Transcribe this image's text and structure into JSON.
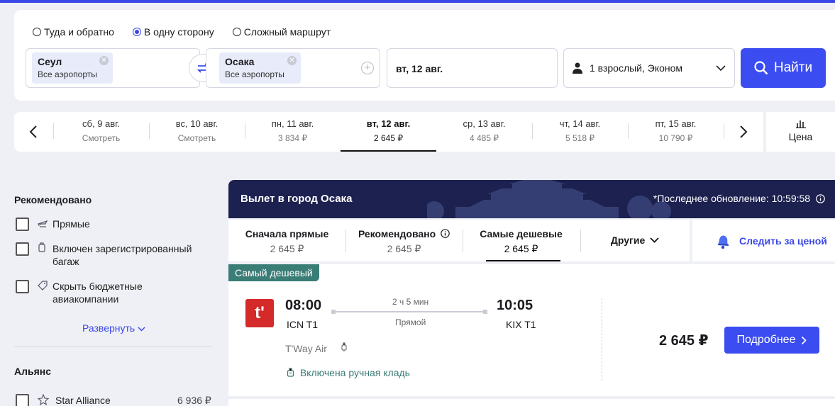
{
  "search": {
    "trip_types": [
      "Туда и обратно",
      "В одну сторону",
      "Сложный маршрут"
    ],
    "trip_selected": 1,
    "origin": {
      "city": "Сеул",
      "airports": "Все аэропорты"
    },
    "destination": {
      "city": "Осака",
      "airports": "Все аэропорты"
    },
    "date": "вт, 12 авг.",
    "passengers": "1 взрослый, Эконом",
    "find_label": "Найти"
  },
  "date_strip": {
    "days": [
      {
        "date": "сб, 9 авг.",
        "price": "Смотреть"
      },
      {
        "date": "вс, 10 авг.",
        "price": "Смотреть"
      },
      {
        "date": "пн, 11 авг.",
        "price": "3 834 ₽"
      },
      {
        "date": "вт, 12 авг.",
        "price": "2 645 ₽"
      },
      {
        "date": "ср, 13 авг.",
        "price": "4 485 ₽"
      },
      {
        "date": "чт, 14 авг.",
        "price": "5 518 ₽"
      },
      {
        "date": "пт, 15 авг.",
        "price": "10 790 ₽"
      }
    ],
    "selected_index": 3,
    "price_chart_label": "Цена"
  },
  "filters": {
    "recommended_heading": "Рекомендовано",
    "options": [
      "Прямые",
      "Включен зарегистрированный багаж",
      "Скрыть бюджетные авиакомпании"
    ],
    "expand_label": "Развернуть",
    "alliance_heading": "Альянс",
    "alliance": {
      "name": "Star Alliance",
      "price": "6 936 ₽"
    }
  },
  "results": {
    "banner_title": "Вылет в город Осака",
    "updated": "*Последнее обновление: 10:59:58",
    "sort": [
      {
        "label": "Сначала прямые",
        "price": "2 645 ₽"
      },
      {
        "label": "Рекомендовано",
        "price": "2 645 ₽"
      },
      {
        "label": "Самые дешевые",
        "price": "2 645 ₽"
      },
      {
        "label": "Другие",
        "price": ""
      }
    ],
    "sort_selected": 2,
    "track_label": "Следить за ценой"
  },
  "flight": {
    "tag": "Самый дешевый",
    "depart_time": "08:00",
    "depart_airport": "ICN T1",
    "duration": "2 ч 5 мин",
    "stops": "Прямой",
    "arrive_time": "10:05",
    "arrive_airport": "KIX T1",
    "airline": "T'Way Air",
    "carry_on": "Включена ручная кладь",
    "price": "2 645 ₽",
    "details_label": "Подробнее",
    "logo_text": "t'"
  },
  "colors": {
    "accent": "#3b4cf0",
    "banner": "#1d2150",
    "tag": "#3a7c76",
    "logo": "#d42a2a"
  },
  "icons": [
    "swap-icon",
    "plus-icon",
    "person-icon",
    "chevron-down-icon",
    "search-icon",
    "chevron-left-icon",
    "chevron-right-icon",
    "bar-chart-icon",
    "plane-icon",
    "luggage-icon",
    "tag-icon",
    "star-alliance-icon",
    "info-icon",
    "bell-icon",
    "carry-on-icon"
  ]
}
